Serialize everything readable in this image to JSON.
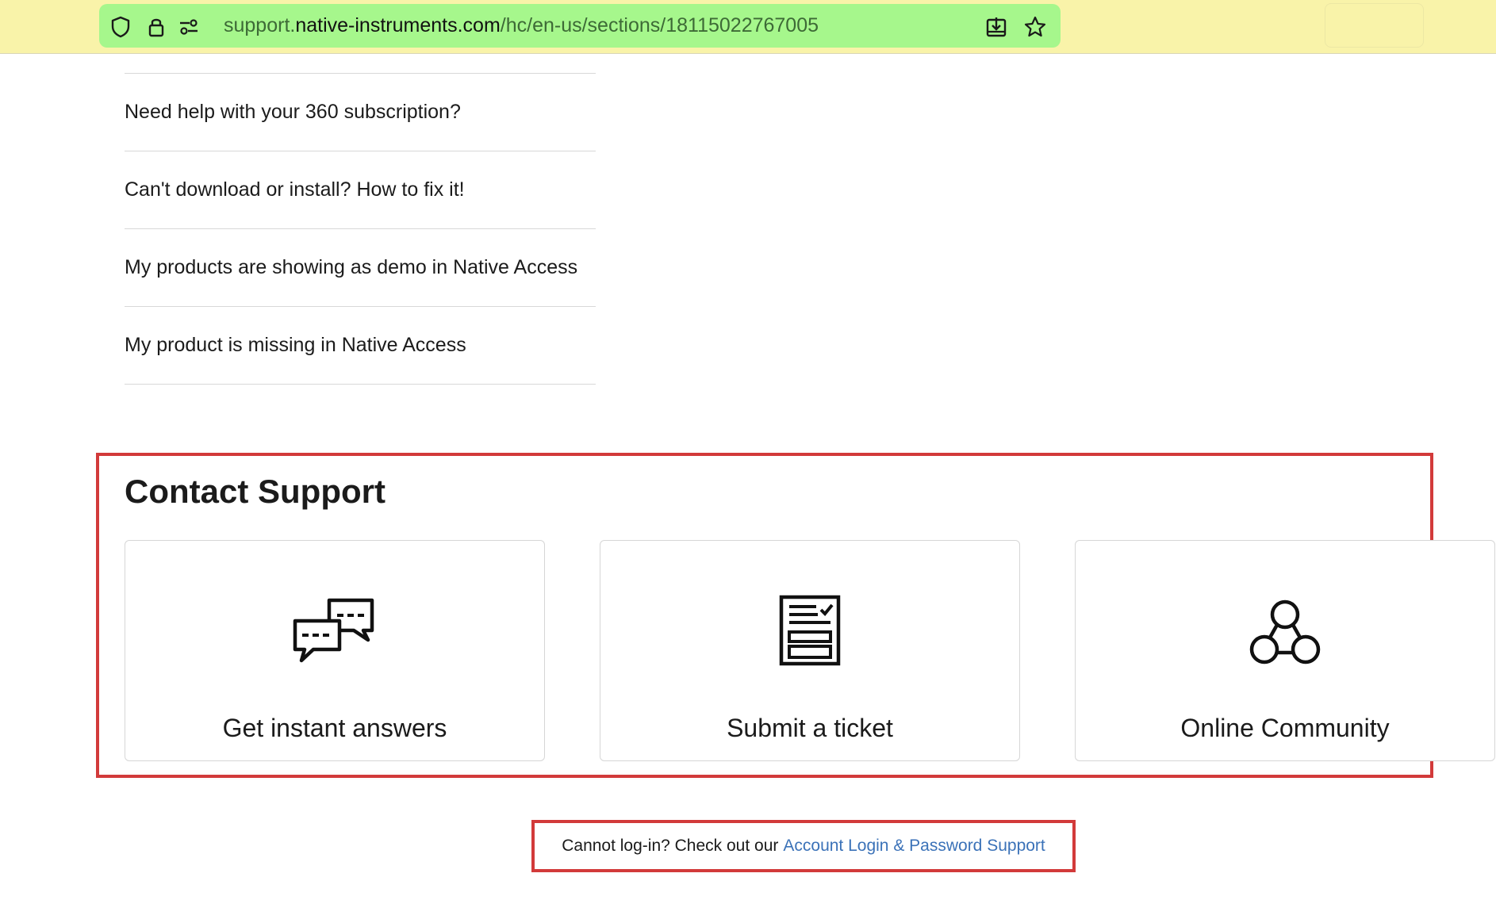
{
  "browser": {
    "url_prefix": "support.",
    "url_host": "native-instruments.com",
    "url_path": "/hc/en-us/sections/18115022767005"
  },
  "articles": [
    {
      "title": "Need help with your 360 subscription?"
    },
    {
      "title": "Can't download or install? How to fix it!"
    },
    {
      "title": "My products are showing as demo in Native Access"
    },
    {
      "title": "My product is missing in Native Access"
    }
  ],
  "contact": {
    "heading": "Contact Support",
    "cards": [
      {
        "label": "Get instant answers",
        "icon": "chat-bubbles-icon"
      },
      {
        "label": "Submit a ticket",
        "icon": "ticket-form-icon"
      },
      {
        "label": "Online Community",
        "icon": "community-icon"
      }
    ]
  },
  "login_help": {
    "text": "Cannot log-in? Check out our",
    "link": "Account Login & Password Support"
  },
  "colors": {
    "urlbar": "#a6f78c",
    "toolbar": "#f9f3a9",
    "highlight": "#d23a3a",
    "link": "#3b72b8"
  }
}
